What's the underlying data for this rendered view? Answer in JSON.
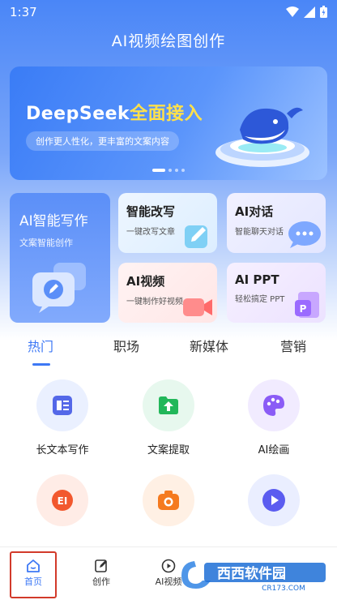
{
  "status_bar": {
    "time": "1:37"
  },
  "app_title": "AI视频绘图创作",
  "banner": {
    "headline_brand": "DeepSeek",
    "headline_highlight": "全面接入",
    "subtitle": "创作更人性化，更丰富的文案内容",
    "dot_count": 4,
    "active_dot": 0
  },
  "feature_cards": {
    "writing": {
      "title": "AI智能写作",
      "subtitle": "文案智能创作"
    },
    "rewrite": {
      "title": "智能改写",
      "subtitle": "一键改写文章"
    },
    "chat": {
      "title": "AI对话",
      "subtitle": "智能聊天对话"
    },
    "video": {
      "title": "AI视频",
      "subtitle": "一键制作好视频"
    },
    "ppt": {
      "title": "AI PPT",
      "subtitle": "轻松搞定 PPT"
    }
  },
  "category_tabs": [
    {
      "label": "热门",
      "active": true
    },
    {
      "label": "职场",
      "active": false
    },
    {
      "label": "新媒体",
      "active": false
    },
    {
      "label": "营销",
      "active": false
    }
  ],
  "tools": [
    {
      "label": "长文本写作",
      "icon": "long-text-icon"
    },
    {
      "label": "文案提取",
      "icon": "extract-icon"
    },
    {
      "label": "AI绘画",
      "icon": "palette-icon"
    },
    {
      "label": "",
      "icon": "ocr-icon"
    },
    {
      "label": "",
      "icon": "camera-icon"
    },
    {
      "label": "",
      "icon": "play-icon"
    }
  ],
  "bottom_nav": [
    {
      "label": "首页",
      "icon": "home-icon",
      "active": true
    },
    {
      "label": "创作",
      "icon": "edit-icon",
      "active": false
    },
    {
      "label": "AI视频",
      "icon": "play-circle-icon",
      "active": false
    },
    {
      "label": "",
      "icon": "",
      "active": false
    },
    {
      "label": "",
      "icon": "",
      "active": false
    }
  ],
  "watermark": {
    "main": "西西软件园",
    "sub": "CR173.COM"
  },
  "colors": {
    "primary": "#3d78f5",
    "highlight": "#ffe14a",
    "focus_box": "#d23a2a"
  }
}
